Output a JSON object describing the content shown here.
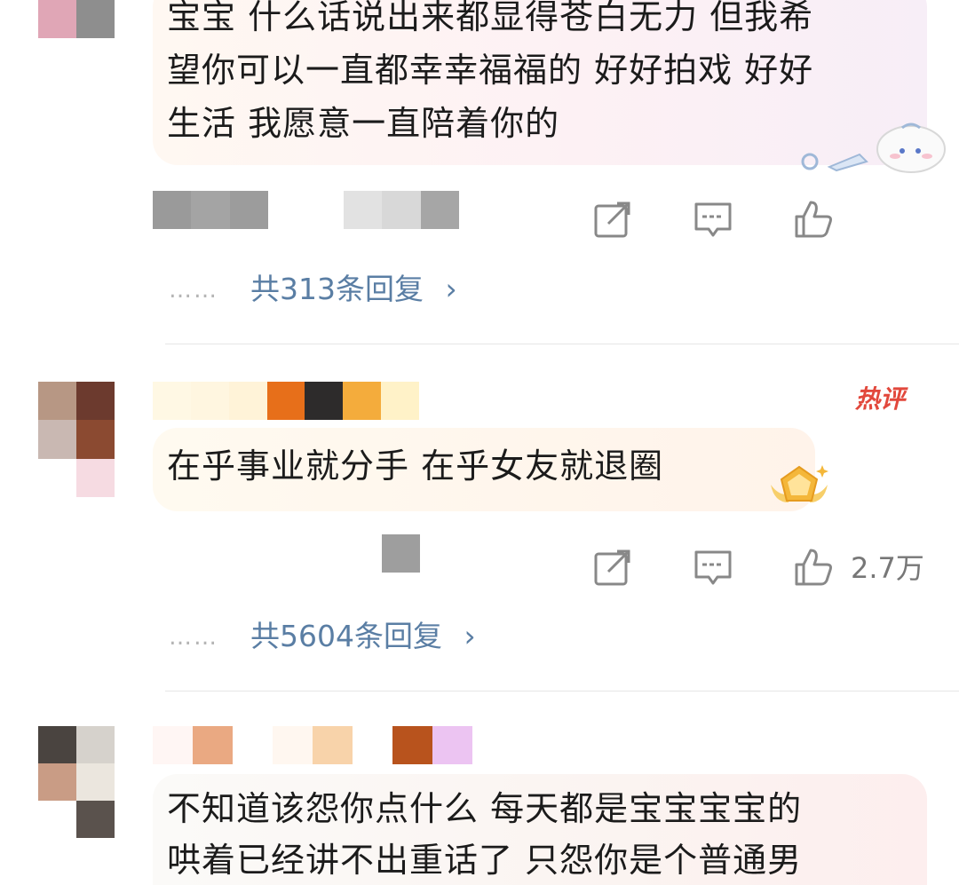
{
  "comments": [
    {
      "text_lines": [
        "宝宝 什么话说出来都显得苍白无力 但我希",
        "望你可以一直都幸幸福福的 好好拍戏 好好",
        "生活 我愿意一直陪着你的"
      ],
      "reply_summary": "共313条回复",
      "dots": "……",
      "chevron": "›",
      "like_count": ""
    },
    {
      "badge": "热评",
      "text_lines": [
        "在乎事业就分手 在乎女友就退圈"
      ],
      "reply_summary": "共5604条回复",
      "dots": "……",
      "chevron": "›",
      "like_count": "2.7万"
    },
    {
      "text_lines": [
        "不知道该怨你点什么 每天都是宝宝宝宝的",
        "哄着已经讲不出重话了 只怨你是个普通男"
      ]
    }
  ],
  "icons": {
    "repost": "share-icon",
    "comment": "comment-icon",
    "like": "thumbs-up-icon"
  },
  "colors": {
    "reply_link": "#5a7ea4",
    "hot_badge": "#e2483c"
  }
}
